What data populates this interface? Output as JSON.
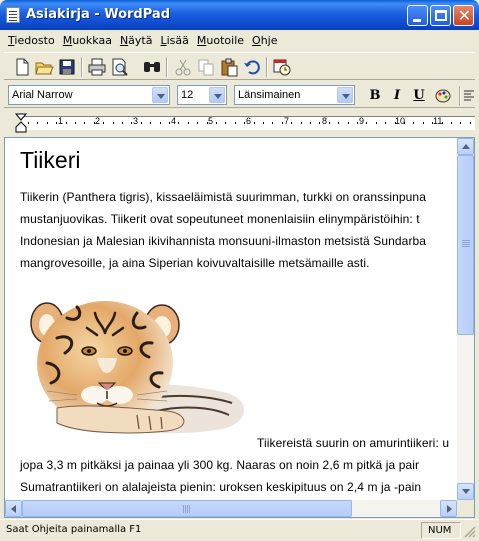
{
  "window": {
    "title": "Asiakirja - WordPad",
    "close_glyph": "✕"
  },
  "menu": [
    "Tiedosto",
    "Muokkaa",
    "Näytä",
    "Lisää",
    "Muotoile",
    "Ohje"
  ],
  "toolbar": {
    "icons": [
      "new-icon",
      "open-icon",
      "save-icon",
      "print-icon",
      "print-preview-icon",
      "find-icon",
      "cut-icon",
      "copy-icon",
      "paste-icon",
      "undo-icon",
      "date-time-icon"
    ]
  },
  "format": {
    "font": "Arial Narrow",
    "size": "12",
    "script": "Länsimainen",
    "bold": "B",
    "italic": "I",
    "underline": "U"
  },
  "ruler": {
    "numbers": [
      "1",
      "2",
      "3",
      "4",
      "5",
      "6",
      "7",
      "8",
      "9",
      "10",
      "11"
    ]
  },
  "document": {
    "title": "Tiikeri",
    "lines": [
      "Tiikerin (Panthera tigris), kissaeläimistä suurimman, turkki on oranssinpuna",
      "mustanjuovikas. Tiikerit ovat sopeutuneet monenlaisiin elinympäristöihin: t",
      "Indonesian ja Malesian ikivihannista monsuuni-ilmaston metsistä Sundarba",
      "mangrovesoille, ja aina Siperian koivuvaltaisille metsämaille asti."
    ],
    "after_image_line": "Tiikereistä suurin on amurintiikeri: u",
    "lines2": [
      "jopa 3,3 m pitkäksi ja painaa yli 300 kg. Naaras on noin 2,6 m pitkä ja pair",
      "Sumatrantiikeri on alalajeista pienin: uroksen keskipituus on 2,4 m ja -pain"
    ]
  },
  "status": {
    "help_text": "Saat Ohjeita painamalla F1",
    "num": "NUM"
  },
  "colors": {
    "titlebar": "#0a5fd8",
    "chrome": "#ece9d8",
    "scroll_accent": "#b9d0f7"
  }
}
